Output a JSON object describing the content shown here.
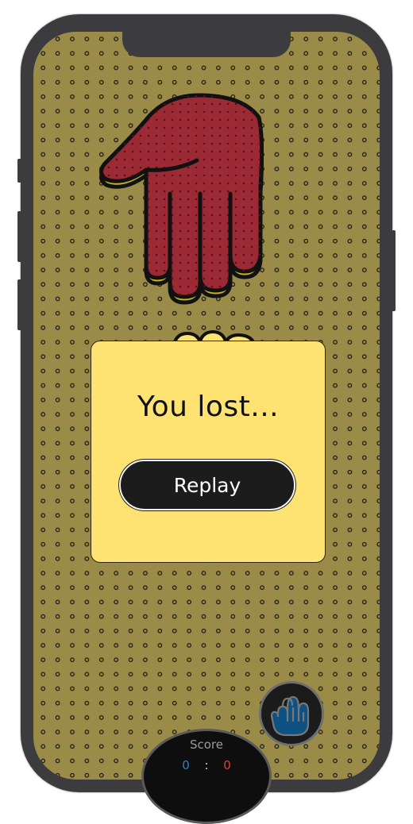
{
  "game": {
    "opponent_choice": "paper-hand",
    "player_choice": "rock-hand",
    "colors": {
      "background": "#9a8b48",
      "opponent_hand": "#9b2a35",
      "player_hand": "#0d5282",
      "modal": "#ffe372",
      "button": "#1c1c1c"
    }
  },
  "result_modal": {
    "title": "You lost...",
    "replay_label": "Replay"
  },
  "score": {
    "label": "Score",
    "player": "0",
    "separator": ":",
    "opponent": "0"
  }
}
